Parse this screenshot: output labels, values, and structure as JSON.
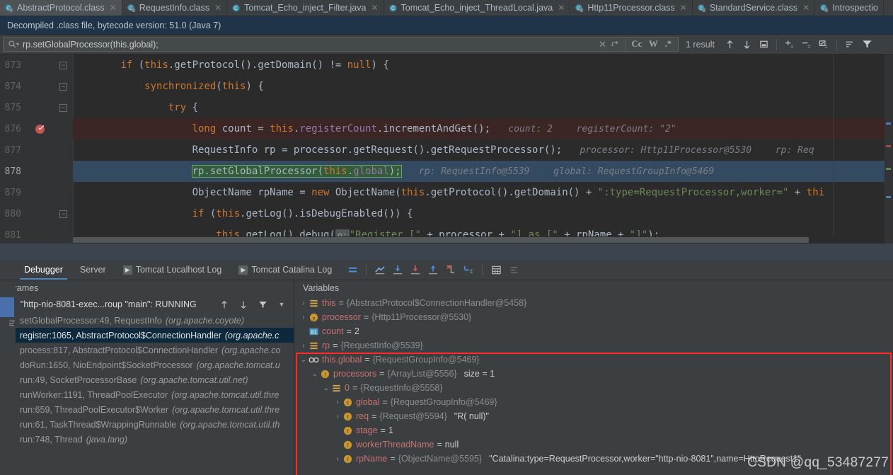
{
  "tabs": [
    {
      "label": "AbstractProtocol.class",
      "icon": "class-decompiled-icon",
      "active": true,
      "closable": true
    },
    {
      "label": "RequestInfo.class",
      "icon": "class-decompiled-icon",
      "active": false,
      "closable": true
    },
    {
      "label": "Tomcat_Echo_inject_Filter.java",
      "icon": "java-file-icon",
      "active": false,
      "closable": true
    },
    {
      "label": "Tomcat_Echo_inject_ThreadLocal.java",
      "icon": "java-file-icon",
      "active": false,
      "closable": true
    },
    {
      "label": "Http11Processor.class",
      "icon": "class-decompiled-icon",
      "active": false,
      "closable": true
    },
    {
      "label": "StandardService.class",
      "icon": "class-decompiled-icon",
      "active": false,
      "closable": true
    },
    {
      "label": "Introspectio",
      "icon": "class-decompiled-icon",
      "active": false,
      "closable": false
    }
  ],
  "notice": {
    "text": "Decompiled .class file, bytecode version: 51.0 (Java 7)"
  },
  "find": {
    "query": "rp.setGlobalProcessor(this.global);",
    "placeholder": "Find in path",
    "search_icon": "magnifier-icon",
    "clear_label": "×",
    "history_icon": "find-history-icon",
    "match_case_label": "Cc",
    "words_label": "W",
    "regex_label": ".*",
    "result_count": "1 result",
    "prev_icon": "arrow-up-icon",
    "next_icon": "arrow-down-icon",
    "select_all_icon": "select-all-occurrences-icon",
    "add_line_icon": "add-line-icon",
    "remove_line_icon": "remove-line-icon",
    "edit_icon": "edit-occurrences-icon",
    "sort_icon": "sort-icon",
    "filter_icon": "filter-icon"
  },
  "editor": {
    "lines": [
      {
        "num": "873",
        "fold": true,
        "breakpoint": false,
        "current": false,
        "indent": 8,
        "tokens": [
          {
            "t": "kw",
            "s": "if"
          },
          {
            "t": "p",
            "s": " ("
          },
          {
            "t": "kw",
            "s": "this"
          },
          {
            "t": "p",
            "s": ".getProtocol()."
          },
          {
            "t": "p",
            "s": "getDomain() != "
          },
          {
            "t": "kw",
            "s": "null"
          },
          {
            "t": "p",
            "s": ") {"
          }
        ]
      },
      {
        "num": "874",
        "fold": true,
        "breakpoint": false,
        "current": false,
        "indent": 12,
        "tokens": [
          {
            "t": "kw",
            "s": "synchronized"
          },
          {
            "t": "p",
            "s": "("
          },
          {
            "t": "kw",
            "s": "this"
          },
          {
            "t": "p",
            "s": ") {"
          }
        ]
      },
      {
        "num": "875",
        "fold": true,
        "breakpoint": false,
        "current": false,
        "indent": 16,
        "tokens": [
          {
            "t": "kw",
            "s": "try"
          },
          {
            "t": "p",
            "s": " {"
          }
        ]
      },
      {
        "num": "876",
        "fold": false,
        "breakpoint": true,
        "current": false,
        "indent": 20,
        "tokens": [
          {
            "t": "kw",
            "s": "long"
          },
          {
            "t": "p",
            "s": " count = "
          },
          {
            "t": "kw",
            "s": "this"
          },
          {
            "t": "p",
            "s": "."
          },
          {
            "t": "fld",
            "s": "registerCount"
          },
          {
            "t": "p",
            "s": ".incrementAndGet();"
          }
        ],
        "hints": [
          {
            "label": "count: 2"
          },
          {
            "label": "registerCount: \"2\""
          }
        ]
      },
      {
        "num": "877",
        "fold": false,
        "breakpoint": false,
        "current": false,
        "indent": 20,
        "tokens": [
          {
            "t": "p",
            "s": "RequestInfo rp = processor.getRequest().getRequestProcessor();"
          }
        ],
        "hints": [
          {
            "label": "processor: Http11Processor@5530"
          },
          {
            "label": "rp: Req"
          }
        ]
      },
      {
        "num": "878",
        "fold": false,
        "breakpoint": false,
        "current": true,
        "indent": 20,
        "hit": "rp.setGlobalProcessor(this.global);",
        "tokens": [
          {
            "t": "p",
            "s": "rp.setGlobalProcessor("
          },
          {
            "t": "kw",
            "s": "this"
          },
          {
            "t": "p",
            "s": "."
          },
          {
            "t": "fld",
            "s": "global"
          },
          {
            "t": "p",
            "s": ");"
          }
        ],
        "hints": [
          {
            "label": "rp: RequestInfo@5539"
          },
          {
            "label": "global: RequestGroupInfo@5469"
          }
        ]
      },
      {
        "num": "879",
        "fold": false,
        "breakpoint": false,
        "current": false,
        "indent": 20,
        "tokens": [
          {
            "t": "p",
            "s": "ObjectName rpName = "
          },
          {
            "t": "kw",
            "s": "new"
          },
          {
            "t": "p",
            "s": " ObjectName("
          },
          {
            "t": "kw",
            "s": "this"
          },
          {
            "t": "p",
            "s": ".getProtocol().getDomain() + "
          },
          {
            "t": "str",
            "s": "\":type=RequestProcessor,worker=\""
          },
          {
            "t": "p",
            "s": " + "
          },
          {
            "t": "kw",
            "s": "thi"
          }
        ]
      },
      {
        "num": "880",
        "fold": true,
        "breakpoint": false,
        "current": false,
        "indent": 20,
        "tokens": [
          {
            "t": "kw",
            "s": "if"
          },
          {
            "t": "p",
            "s": " ("
          },
          {
            "t": "kw",
            "s": "this"
          },
          {
            "t": "p",
            "s": ".getLog().isDebugEnabled()) {"
          }
        ]
      },
      {
        "num": "881",
        "fold": false,
        "breakpoint": false,
        "current": false,
        "indent": 24,
        "tokens": [
          {
            "t": "kw",
            "s": "this"
          },
          {
            "t": "p",
            "s": ".getLog().debug("
          },
          {
            "t": "ph",
            "s": "o:"
          },
          {
            "t": "str",
            "s": "\"Register [\""
          },
          {
            "t": "p",
            "s": " + processor + "
          },
          {
            "t": "str",
            "s": "\"] as [\""
          },
          {
            "t": "p",
            "s": " + rpName + "
          },
          {
            "t": "str",
            "s": "\"]\""
          },
          {
            "t": "p",
            "s": ");"
          }
        ]
      }
    ]
  },
  "debug": {
    "tabs": [
      {
        "label": "Debugger",
        "active": true,
        "icon": null
      },
      {
        "label": "Server",
        "active": false,
        "icon": null
      },
      {
        "label": "Tomcat Localhost Log",
        "active": false,
        "icon": "console-run-icon"
      },
      {
        "label": "Tomcat Catalina Log",
        "active": false,
        "icon": "console-run-icon"
      }
    ],
    "toolbar": [
      {
        "name": "layout-settings-icon"
      },
      {
        "name": "show-execution-point-icon"
      },
      {
        "name": "step-over-icon"
      },
      {
        "name": "step-into-icon"
      },
      {
        "name": "step-out-icon"
      },
      {
        "name": "force-step-into-icon"
      },
      {
        "name": "run-to-cursor-icon"
      },
      {
        "name": "evaluate-expression-icon"
      },
      {
        "name": "mute-breakpoints-icon"
      }
    ],
    "frames": {
      "title": "Frames",
      "thread": "\"http-nio-8081-exec...roup \"main\": RUNNING",
      "thread_check_icon": "check-icon",
      "up_icon": "arrow-up-icon",
      "down_icon": "arrow-down-icon",
      "filter_icon": "filter-icon",
      "dropdown_icon": "chevron-down-icon",
      "rows": [
        {
          "method": "setGlobalProcessor:49, RequestInfo",
          "pkg": "(org.apache.coyote)",
          "selected": false
        },
        {
          "method": "register:1065, AbstractProtocol$ConnectionHandler",
          "pkg": "(org.apache.c",
          "selected": true
        },
        {
          "method": "process:817, AbstractProtocol$ConnectionHandler",
          "pkg": "(org.apache.co",
          "selected": false
        },
        {
          "method": "doRun:1650, NioEndpoint$SocketProcessor",
          "pkg": "(org.apache.tomcat.u",
          "selected": false
        },
        {
          "method": "run:49, SocketProcessorBase",
          "pkg": "(org.apache.tomcat.util.net)",
          "selected": false
        },
        {
          "method": "runWorker:1191, ThreadPoolExecutor",
          "pkg": "(org.apache.tomcat.util.thre",
          "selected": false
        },
        {
          "method": "run:659, ThreadPoolExecutor$Worker",
          "pkg": "(org.apache.tomcat.util.thre",
          "selected": false
        },
        {
          "method": "run:61, TaskThread$WrappingRunnable",
          "pkg": "(org.apache.tomcat.util.th",
          "selected": false
        },
        {
          "method": "run:748, Thread",
          "pkg": "(java.lang)",
          "selected": false
        }
      ]
    },
    "variables": {
      "title": "Variables",
      "rows": [
        {
          "depth": 0,
          "arrow": "collapsed",
          "icon": "object-icon",
          "name": "this",
          "eq": "=",
          "value": "{AbstractProtocol$ConnectionHandler@5458}",
          "extra": "",
          "inbox": false
        },
        {
          "depth": 0,
          "arrow": "collapsed",
          "icon": "parameter-icon",
          "name": "processor",
          "eq": "=",
          "value": "{Http11Processor@5530}",
          "extra": "",
          "inbox": false
        },
        {
          "depth": 0,
          "arrow": "none",
          "icon": "primitive-icon",
          "name": "count",
          "eq": "=",
          "value": "2",
          "value_kind": "num",
          "extra": "",
          "inbox": false
        },
        {
          "depth": 0,
          "arrow": "collapsed",
          "icon": "object-icon",
          "name": "rp",
          "eq": "=",
          "value": "{RequestInfo@5539}",
          "extra": "",
          "inbox": false
        },
        {
          "depth": 0,
          "arrow": "expanded",
          "icon": "watch-icon",
          "name": "this.global",
          "eq": "=",
          "value": "{RequestGroupInfo@5469}",
          "extra": "",
          "inbox": true
        },
        {
          "depth": 1,
          "arrow": "expanded",
          "icon": "field-icon",
          "name": "processors",
          "eq": "=",
          "value": "{ArrayList@5556}",
          "extra": "size = 1",
          "inbox": true
        },
        {
          "depth": 2,
          "arrow": "expanded",
          "icon": "object-icon",
          "name": "0",
          "eq": "=",
          "value": "{RequestInfo@5558}",
          "extra": "",
          "inbox": true
        },
        {
          "depth": 3,
          "arrow": "collapsed",
          "icon": "field-icon",
          "name": "global",
          "eq": "=",
          "value": "{RequestGroupInfo@5469}",
          "extra": "",
          "inbox": true
        },
        {
          "depth": 3,
          "arrow": "collapsed",
          "icon": "field-icon",
          "name": "req",
          "eq": "=",
          "value": "{Request@5594}",
          "extra": "\"R( null)\"",
          "inbox": true
        },
        {
          "depth": 3,
          "arrow": "none",
          "icon": "field-icon",
          "name": "stage",
          "eq": "=",
          "value": "1",
          "value_kind": "num",
          "extra": "",
          "inbox": true
        },
        {
          "depth": 3,
          "arrow": "none",
          "icon": "field-icon",
          "name": "workerThreadName",
          "eq": "=",
          "value": "null",
          "value_kind": "num",
          "extra": "",
          "inbox": true
        },
        {
          "depth": 3,
          "arrow": "collapsed",
          "icon": "field-icon",
          "name": "rpName",
          "eq": "=",
          "value": "{ObjectName@5595}",
          "extra": "\"Catalina:type=RequestProcessor,worker=\"http-nio-8081\",name=HttpRequest1\"",
          "inbox": true
        }
      ]
    }
  },
  "watermark": {
    "text": "CSDN @qq_53487277"
  },
  "colors": {
    "accent": "#4a88c7",
    "breakpoint": "#c75450",
    "redbox": "#ff2a2a",
    "current_line": "#344a61",
    "search_hit": "#335c39",
    "keyword": "#cc7832",
    "string": "#6a8759",
    "field": "#9876aa"
  }
}
